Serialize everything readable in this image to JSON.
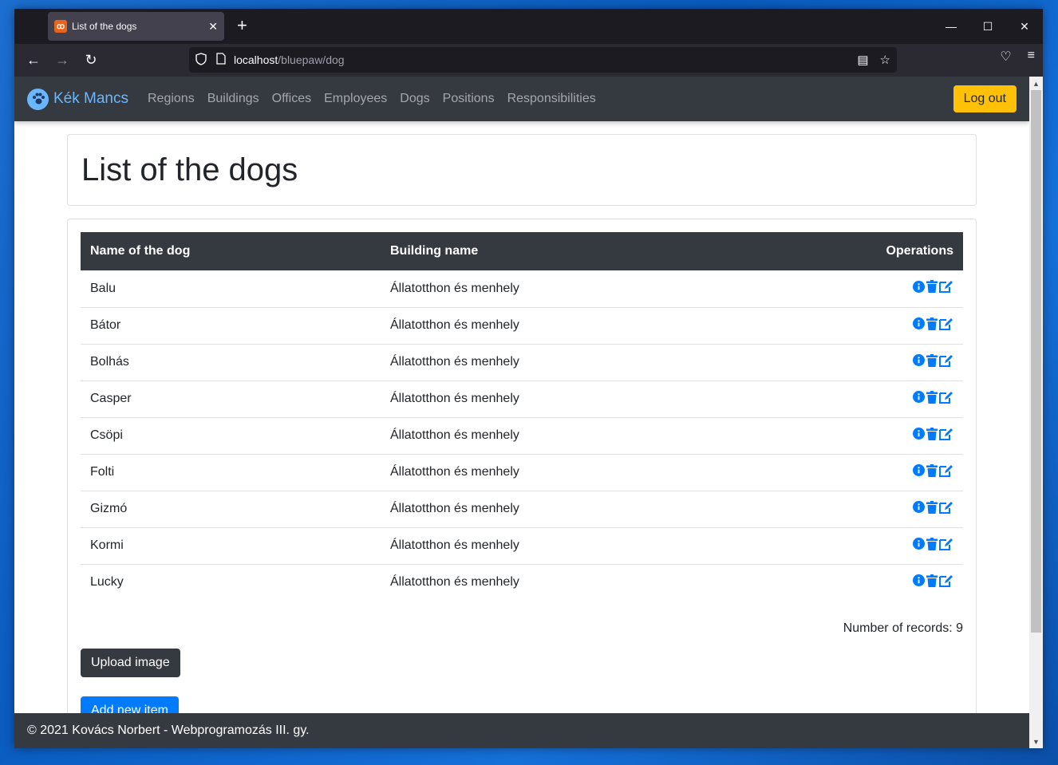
{
  "browser": {
    "tab_title": "List of the dogs",
    "url_host": "localhost",
    "url_path": "/bluepaw/dog"
  },
  "app": {
    "brand": "Kék Mancs",
    "nav": [
      "Regions",
      "Buildings",
      "Offices",
      "Employees",
      "Dogs",
      "Positions",
      "Responsibilities"
    ],
    "logout_label": "Log out"
  },
  "page": {
    "title": "List of the dogs",
    "columns": {
      "name": "Name of the dog",
      "building": "Building name",
      "operations": "Operations"
    },
    "rows": [
      {
        "name": "Balu",
        "building": "Állatotthon és menhely"
      },
      {
        "name": "Bátor",
        "building": "Állatotthon és menhely"
      },
      {
        "name": "Bolhás",
        "building": "Állatotthon és menhely"
      },
      {
        "name": "Casper",
        "building": "Állatotthon és menhely"
      },
      {
        "name": "Csöpi",
        "building": "Állatotthon és menhely"
      },
      {
        "name": "Folti",
        "building": "Állatotthon és menhely"
      },
      {
        "name": "Gizmó",
        "building": "Állatotthon és menhely"
      },
      {
        "name": "Kormi",
        "building": "Állatotthon és menhely"
      },
      {
        "name": "Lucky",
        "building": "Állatotthon és menhely"
      }
    ],
    "records_text": "Number of records: 9",
    "upload_label": "Upload image",
    "add_label": "Add new item"
  },
  "footer": {
    "text": "© 2021 Kovács Norbert - Webprogramozás III. gy."
  },
  "colors": {
    "accent": "#007bff",
    "warning": "#ffc107",
    "dark": "#343a40",
    "brand": "#6ab7ff"
  },
  "icons": {
    "row_operations": [
      "info-icon",
      "trash-icon",
      "edit-icon"
    ]
  }
}
